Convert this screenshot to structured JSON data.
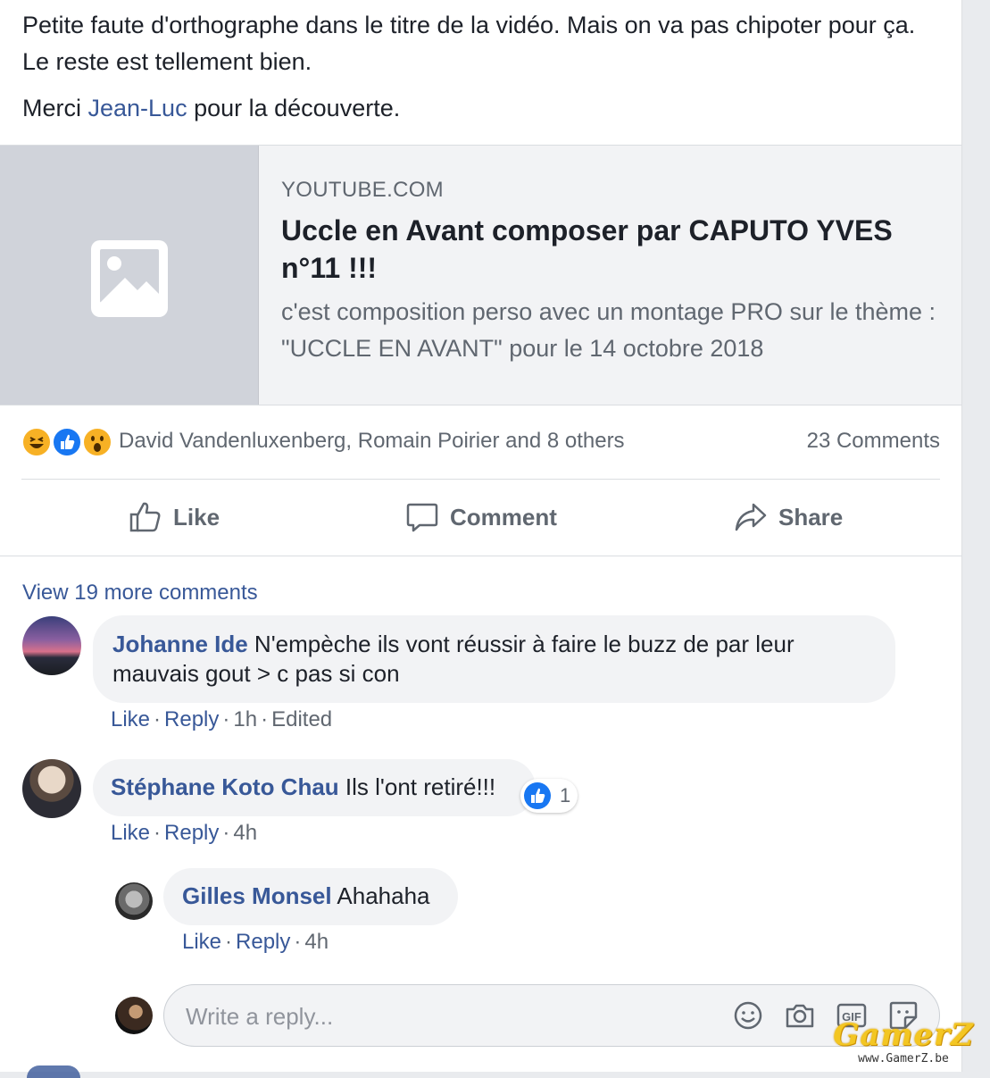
{
  "post": {
    "text_line1": "Petite faute d'orthographe dans le titre de la vidéo. Mais on va pas chipoter pour ça. Le reste est tellement bien.",
    "text_merci_before": "Merci ",
    "text_merci_link": "Jean-Luc",
    "text_merci_after": " pour la découverte."
  },
  "preview": {
    "thumbnail_icon": "image-placeholder-icon",
    "domain": "YOUTUBE.COM",
    "title": "Uccle en Avant composer par CAPUTO YVES n°11 !!!",
    "description": "c'est composition perso avec un montage PRO sur le thème : \"UCCLE EN AVANT\" pour le 14 octobre 2018"
  },
  "reactions": {
    "icons": [
      "haha-reaction-icon",
      "like-reaction-icon",
      "wow-reaction-icon"
    ],
    "names": "David Vandenluxenberg, Romain Poirier and 8 others",
    "comments_count": "23 Comments"
  },
  "actions": {
    "like": "Like",
    "comment": "Comment",
    "share": "Share"
  },
  "comments": {
    "view_more": "View 19 more comments",
    "items": [
      {
        "author": "Johanne Ide",
        "text": " N'empèche ils vont réussir à faire le buzz de par leur mauvais gout > c pas si con",
        "like": "Like",
        "reply": "Reply",
        "time": "1h",
        "edited": "Edited"
      },
      {
        "author": "Stéphane Koto Chau",
        "text": " Ils l'ont retiré!!!",
        "like": "Like",
        "reply": "Reply",
        "time": "4h",
        "like_count": "1"
      }
    ],
    "reply": {
      "author": "Gilles Monsel",
      "text": " Ahahaha",
      "like": "Like",
      "reply": "Reply",
      "time": "4h"
    }
  },
  "reply_box": {
    "placeholder": "Write a reply...",
    "buttons": [
      "emoji-icon",
      "camera-icon",
      "gif-icon",
      "sticker-icon"
    ]
  },
  "watermark": {
    "logo": "GamerZ",
    "url": "www.GamerZ.be"
  },
  "colors": {
    "link": "#385898",
    "secondary_text": "#606770",
    "like_blue": "#1877f2",
    "reaction_yellow": "#f7b125",
    "bubble_bg": "#f2f3f5"
  }
}
